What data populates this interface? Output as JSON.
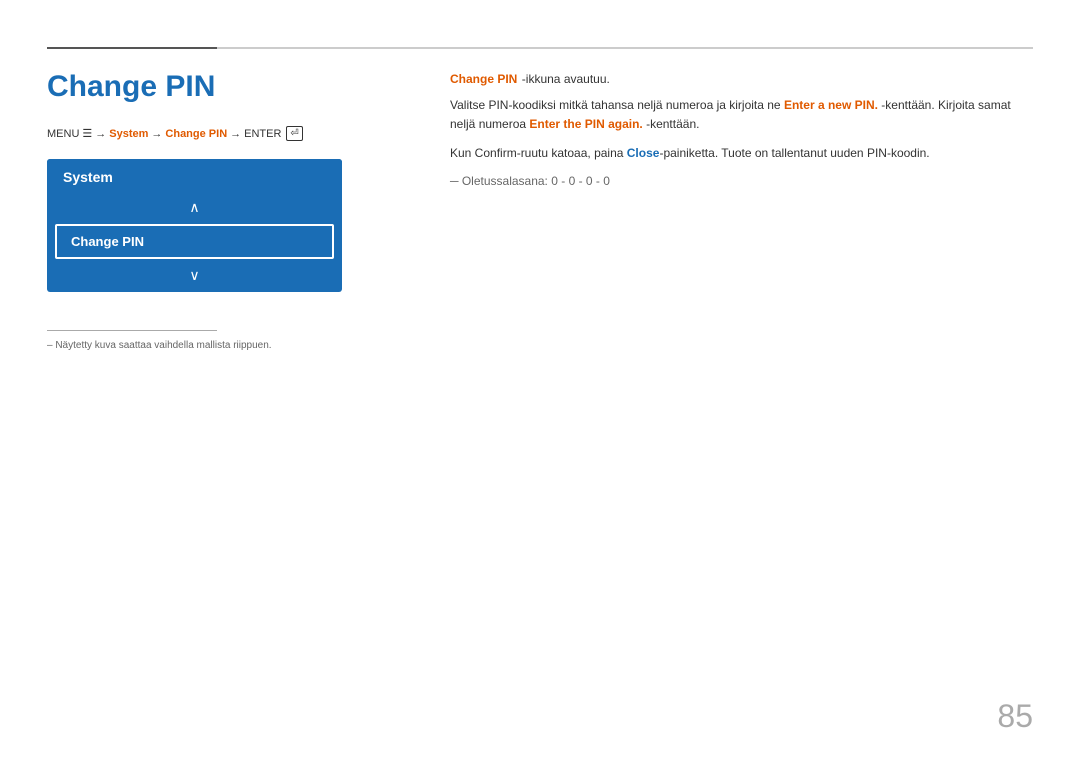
{
  "page": {
    "title": "Change PIN",
    "page_number": "85"
  },
  "top_rule": {
    "label": "top-divider"
  },
  "menu_path": {
    "menu": "MENU",
    "arrow1": "→",
    "system": "System",
    "arrow2": "→",
    "change_pin": "Change PIN",
    "arrow3": "→",
    "enter": "ENTER"
  },
  "system_box": {
    "header": "System",
    "arrow_up": "∧",
    "item": "Change PIN",
    "arrow_down": "∨"
  },
  "footnote": {
    "divider": "",
    "text": "– Näytetty kuva saattaa vaihdella mallista riippuen."
  },
  "right_content": {
    "title": "Change PIN",
    "title_suffix": " -ikkuna avautuu.",
    "para1_prefix": "Valitse PIN-koodiksi mitkä tahansa neljä numeroa ja kirjoita ne ",
    "para1_highlight1": "Enter a new PIN.",
    "para1_mid": " -kenttään. Kirjoita samat neljä numeroa ",
    "para1_highlight2": "Enter the PIN again.",
    "para1_suffix": " -kenttään.",
    "para2_prefix": "Kun Confirm-ruutu katoaa, paina ",
    "para2_highlight": "Close",
    "para2_suffix": "-painiketta. Tuote on tallentanut uuden PIN-koodin.",
    "default_pin": "Oletussalasana: 0 - 0 - 0 - 0"
  }
}
